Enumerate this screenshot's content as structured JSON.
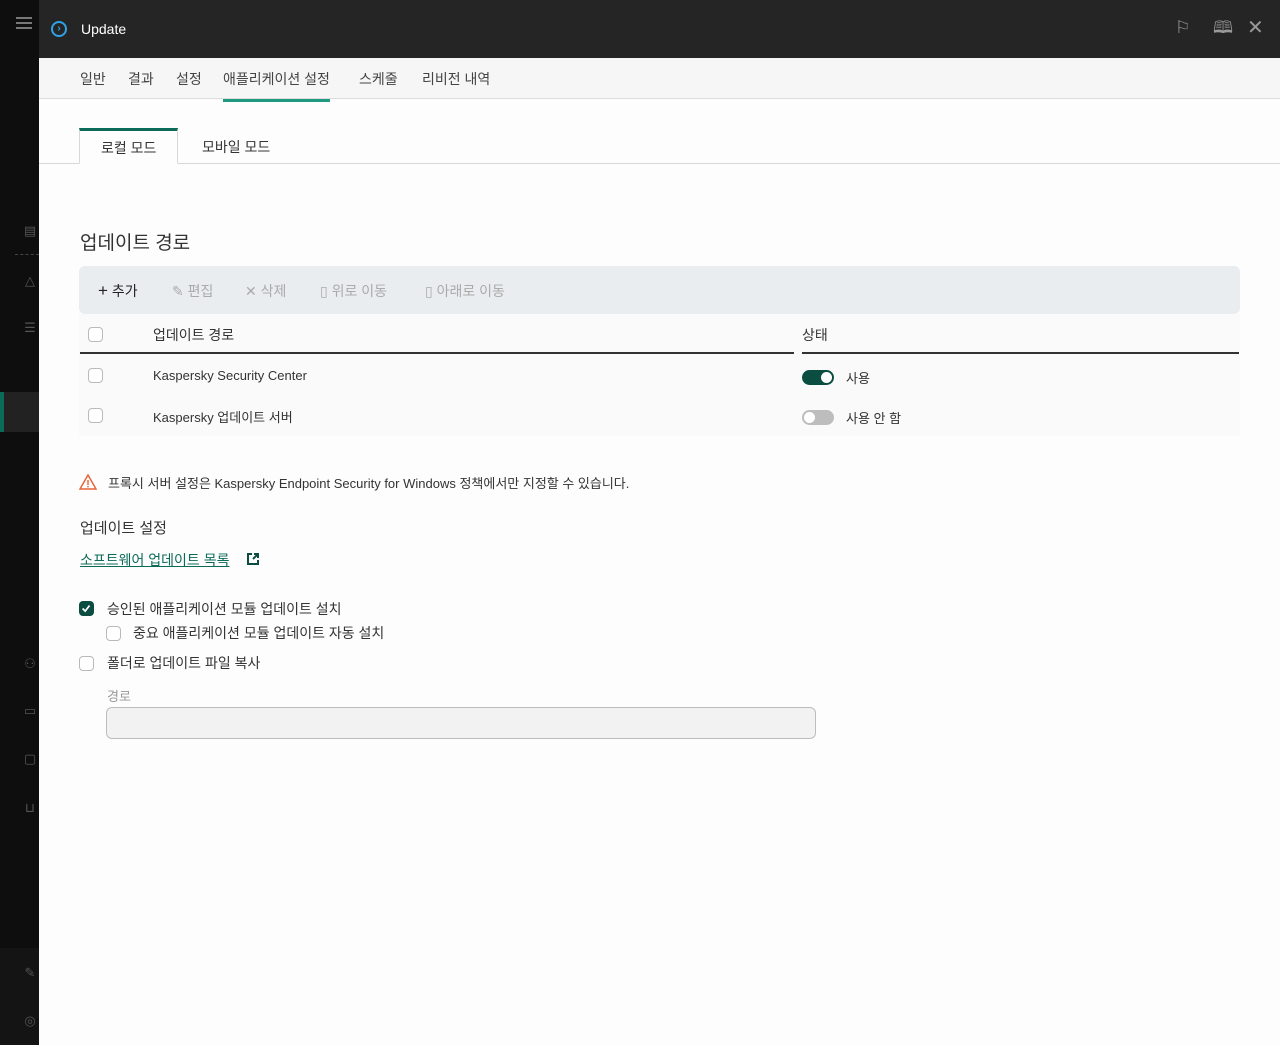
{
  "header": {
    "title": "Update"
  },
  "tabs": [
    "일반",
    "결과",
    "설정",
    "애플리케이션 설정",
    "스케줄",
    "리비전 내역"
  ],
  "subtabs": [
    "로컬 모드",
    "모바일 모드"
  ],
  "section_title": "업데이트 경로",
  "toolbar": {
    "add": "추가",
    "edit": "편집",
    "delete": "삭제",
    "move_up": "위로 이동",
    "move_down": "아래로 이동"
  },
  "table": {
    "columns": [
      "업데이트 경로",
      "상태"
    ],
    "rows": [
      {
        "path": "Kaspersky Security Center",
        "status": "사용",
        "enabled": true
      },
      {
        "path": "Kaspersky 업데이트 서버",
        "status": "사용 안 함",
        "enabled": false
      }
    ]
  },
  "warning": "프록시 서버 설정은 Kaspersky Endpoint Security for Windows 정책에서만 지정할 수 있습니다.",
  "update_settings": {
    "title": "업데이트 설정",
    "link": "소프트웨어 업데이트 목록",
    "options": [
      {
        "label": "승인된 애플리케이션 모듈 업데이트 설치",
        "checked": true
      },
      {
        "label": "중요 애플리케이션 모듈 업데이트 자동 설치",
        "checked": false
      },
      {
        "label": "폴더로 업데이트 파일 복사",
        "checked": false
      }
    ],
    "path_label": "경로",
    "path_value": ""
  },
  "colors": {
    "accent": "#0b6b58",
    "tab_underline": "#1f9a80",
    "header_bg": "#252525"
  }
}
